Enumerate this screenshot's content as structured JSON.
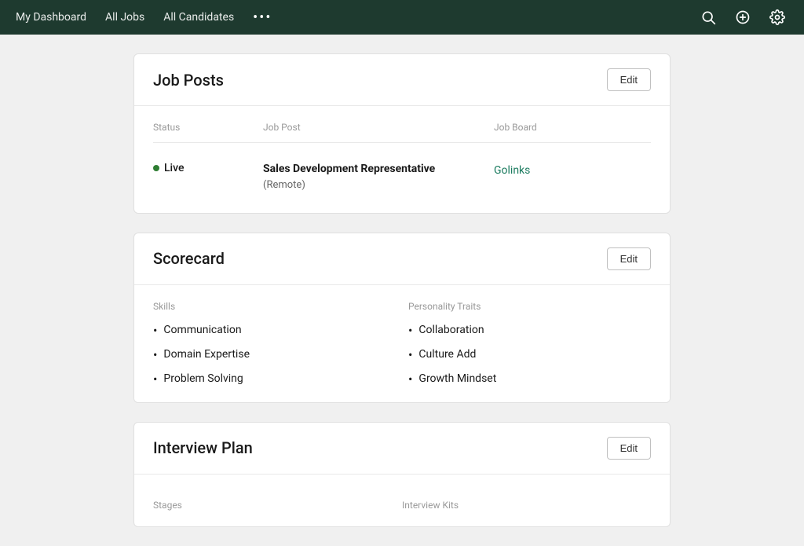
{
  "navbar": {
    "links": [
      {
        "label": "My Dashboard",
        "id": "my-dashboard"
      },
      {
        "label": "All Jobs",
        "id": "all-jobs"
      },
      {
        "label": "All Candidates",
        "id": "all-candidates"
      }
    ],
    "more_label": "•••",
    "icons": {
      "search": "search-icon",
      "add": "add-circle-icon",
      "settings": "gear-icon"
    }
  },
  "job_posts_card": {
    "title": "Job Posts",
    "edit_label": "Edit",
    "table": {
      "columns": [
        "Status",
        "Job Post",
        "Job Board"
      ],
      "rows": [
        {
          "status": "Live",
          "job_post_title": "Sales Development Representative",
          "job_post_sub": "(Remote)",
          "job_board": "Golinks"
        }
      ]
    }
  },
  "scorecard_card": {
    "title": "Scorecard",
    "edit_label": "Edit",
    "skills_label": "Skills",
    "personality_label": "Personality Traits",
    "skills": [
      "Communication",
      "Domain Expertise",
      "Problem Solving"
    ],
    "personality_traits": [
      "Collaboration",
      "Culture Add",
      "Growth Mindset"
    ]
  },
  "interview_plan_card": {
    "title": "Interview Plan",
    "edit_label": "Edit",
    "stages_label": "Stages",
    "interview_kits_label": "Interview Kits"
  }
}
